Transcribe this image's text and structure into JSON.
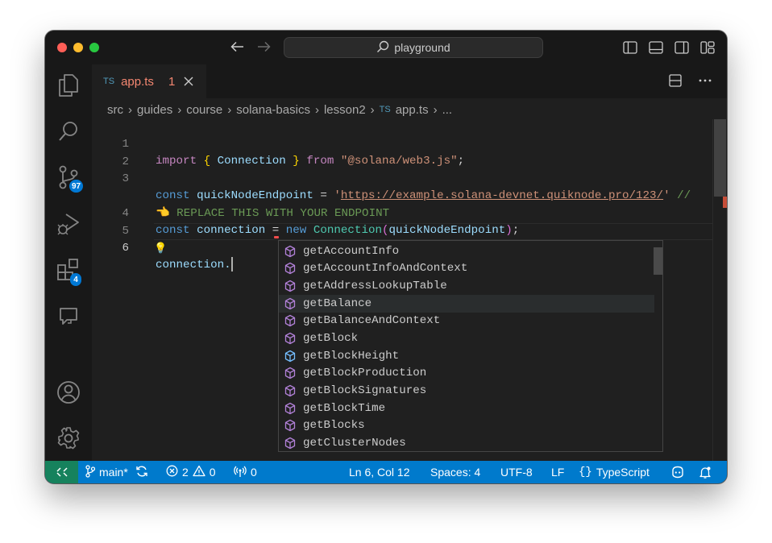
{
  "titlebar": {
    "search_text": "playground",
    "icons": [
      "back-arrow-icon",
      "forward-arrow-icon",
      "search-icon",
      "toggle-primary-sidebar-icon",
      "toggle-panel-icon",
      "toggle-secondary-sidebar-icon",
      "customize-layout-icon"
    ]
  },
  "activity_bar": {
    "items": [
      {
        "name": "explorer",
        "icon": "files-icon"
      },
      {
        "name": "search",
        "icon": "search-icon"
      },
      {
        "name": "source-control",
        "icon": "source-control-icon",
        "badge": "97"
      },
      {
        "name": "run-and-debug",
        "icon": "run-debug-icon"
      },
      {
        "name": "extensions",
        "icon": "extensions-icon",
        "badge": "4"
      },
      {
        "name": "chat",
        "icon": "chat-icon"
      }
    ],
    "bottom_items": [
      {
        "name": "accounts",
        "icon": "account-icon"
      },
      {
        "name": "manage",
        "icon": "gear-icon"
      }
    ]
  },
  "tab": {
    "file_icon": "TS",
    "name": "app.ts",
    "problems": "1"
  },
  "breadcrumb": {
    "parts": [
      "src",
      "guides",
      "course",
      "solana-basics",
      "lesson2"
    ],
    "file_icon": "TS",
    "file": "app.ts",
    "more": "..."
  },
  "editor": {
    "line_numbers": [
      "1",
      "2",
      "3",
      "",
      "4",
      "5",
      "6"
    ],
    "code": {
      "l1": [
        "import",
        "{",
        "Connection",
        "}",
        "from",
        "\"@solana/web3.js\"",
        ";"
      ],
      "l3": [
        "const",
        "quickNodeEndpoint",
        "=",
        "'",
        "https://example.solana-devnet.quiknode.pro/123/",
        "'",
        "//"
      ],
      "l3_wrap": "👈 REPLACE THIS WITH YOUR ENDPOINT",
      "l4": [
        "const",
        "connection",
        "=",
        "new",
        "Connection",
        "(",
        "quickNodeEndpoint",
        ")",
        ";"
      ],
      "l6": "connection."
    },
    "lightbulb": "💡"
  },
  "suggestions": {
    "items": [
      "getAccountInfo",
      "getAccountInfoAndContext",
      "getAddressLookupTable",
      "getBalance",
      "getBalanceAndContext",
      "getBlock",
      "getBlockHeight",
      "getBlockProduction",
      "getBlockSignatures",
      "getBlockTime",
      "getBlocks",
      "getClusterNodes"
    ],
    "selected": "getBalance"
  },
  "statusbar": {
    "branch": "main*",
    "errors": "2",
    "warnings": "0",
    "ports": "0",
    "position": "Ln 6, Col 12",
    "indent": "Spaces: 4",
    "encoding": "UTF-8",
    "eol": "LF",
    "language": "TypeScript",
    "colors": {
      "background": "#007acc",
      "remote": "#16825d"
    }
  }
}
